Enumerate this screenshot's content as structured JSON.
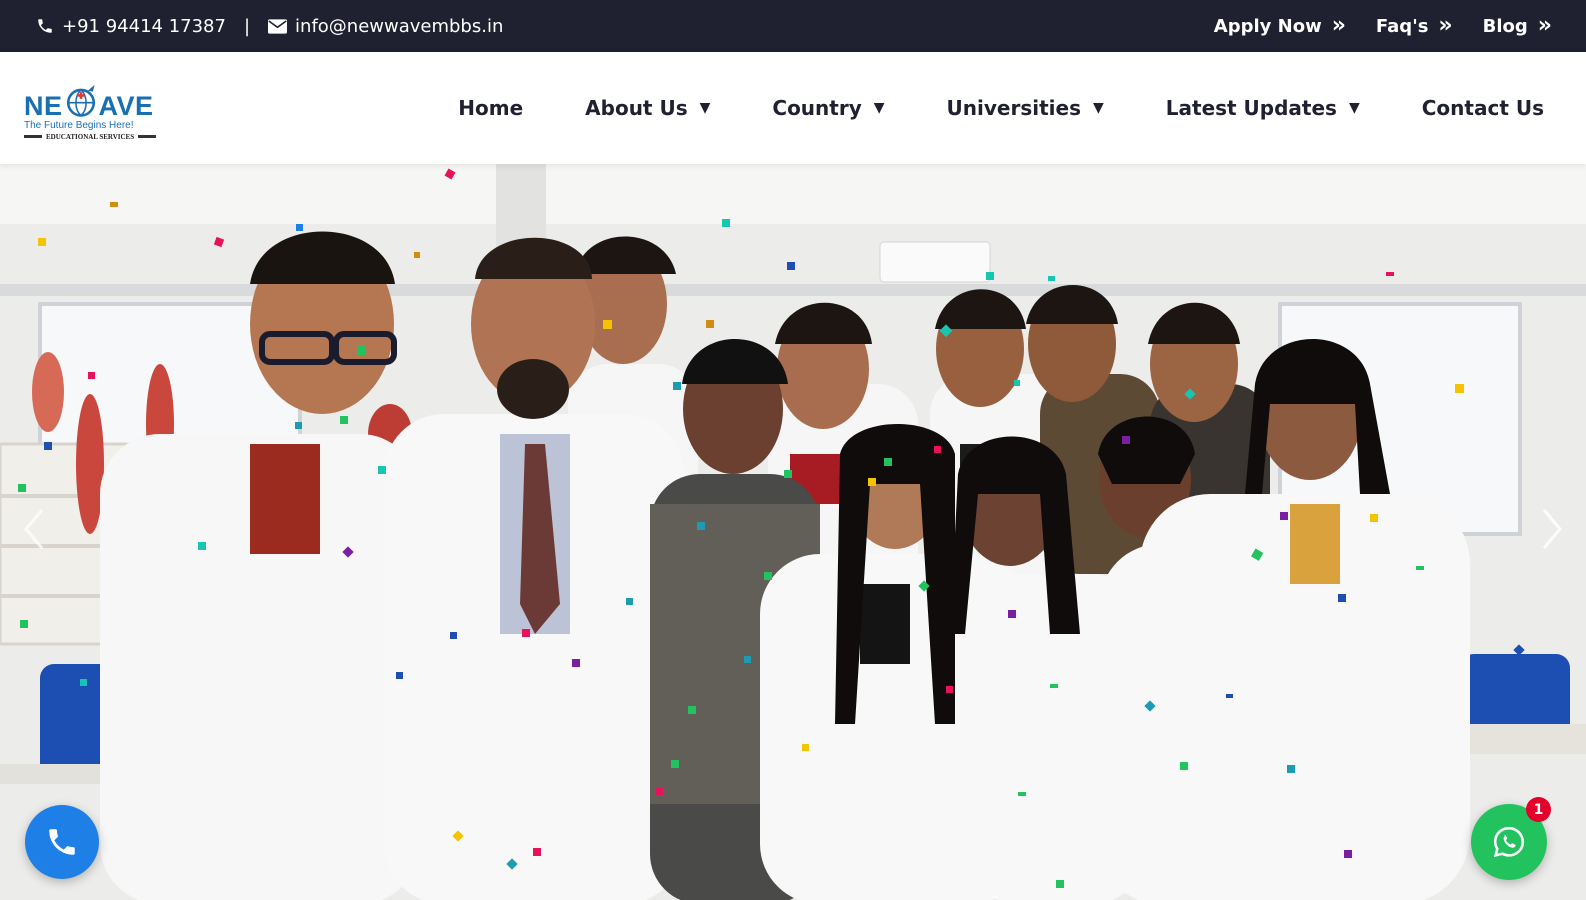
{
  "topbar": {
    "phone": "+91 94414 17387",
    "separator": "|",
    "email": "info@newwavembbs.in",
    "links": [
      {
        "label": "Apply Now",
        "chevron": "»"
      },
      {
        "label": "Faq's",
        "chevron": "»"
      },
      {
        "label": "Blog",
        "chevron": "»"
      }
    ]
  },
  "logo": {
    "text_left": "NE",
    "text_right": "AVE",
    "tagline": "The Future Begins Here!",
    "subtitle": "EDUCATIONAL SERVICES"
  },
  "nav": {
    "items": [
      {
        "label": "Home",
        "dropdown": false
      },
      {
        "label": "About Us",
        "dropdown": true
      },
      {
        "label": "Country",
        "dropdown": true
      },
      {
        "label": "Universities",
        "dropdown": true
      },
      {
        "label": "Latest Updates",
        "dropdown": true
      },
      {
        "label": "Contact Us",
        "dropdown": false
      }
    ],
    "caret": "▼"
  },
  "hero": {
    "prev_icon": "chevron-left-icon",
    "next_icon": "chevron-right-icon"
  },
  "floating": {
    "call_icon": "phone-icon",
    "whatsapp_icon": "whatsapp-icon",
    "whatsapp_badge": "1"
  },
  "colors": {
    "topbar_bg": "#1f2030",
    "nav_text": "#1f2030",
    "brand_blue": "#1a6fb3",
    "call_button": "#1e7fe6",
    "whatsapp_button": "#22c35e",
    "badge_red": "#e4002b"
  }
}
